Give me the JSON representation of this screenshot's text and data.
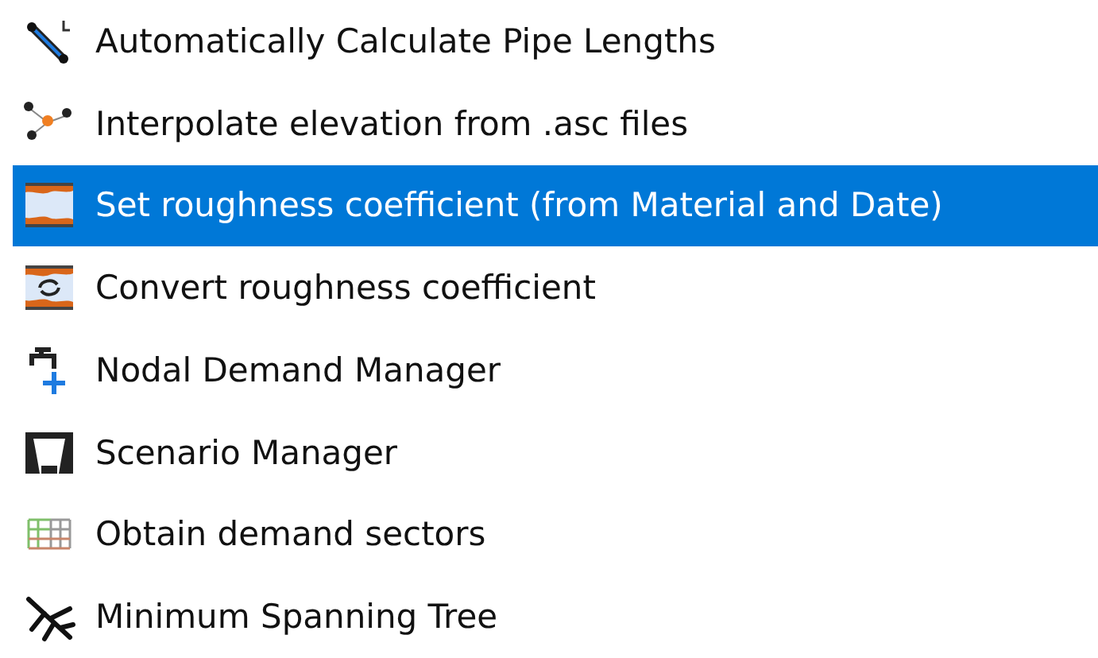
{
  "menu": {
    "items": [
      {
        "kind": "pipe-length",
        "label": "Automatically Calculate Pipe Lengths",
        "selected": false
      },
      {
        "kind": "elevation",
        "label": "Interpolate elevation from .asc files",
        "selected": false
      },
      {
        "kind": "roughness",
        "label": "Set roughness coefficient (from Material and Date)",
        "selected": true
      },
      {
        "kind": "convert",
        "label": "Convert roughness coefficient",
        "selected": false
      },
      {
        "kind": "demand",
        "label": "Nodal Demand Manager",
        "selected": false
      },
      {
        "kind": "scenario",
        "label": "Scenario Manager",
        "selected": false
      },
      {
        "kind": "sectors",
        "label": "Obtain demand sectors",
        "selected": false
      },
      {
        "kind": "tree",
        "label": "Minimum Spanning Tree",
        "selected": false
      }
    ]
  }
}
